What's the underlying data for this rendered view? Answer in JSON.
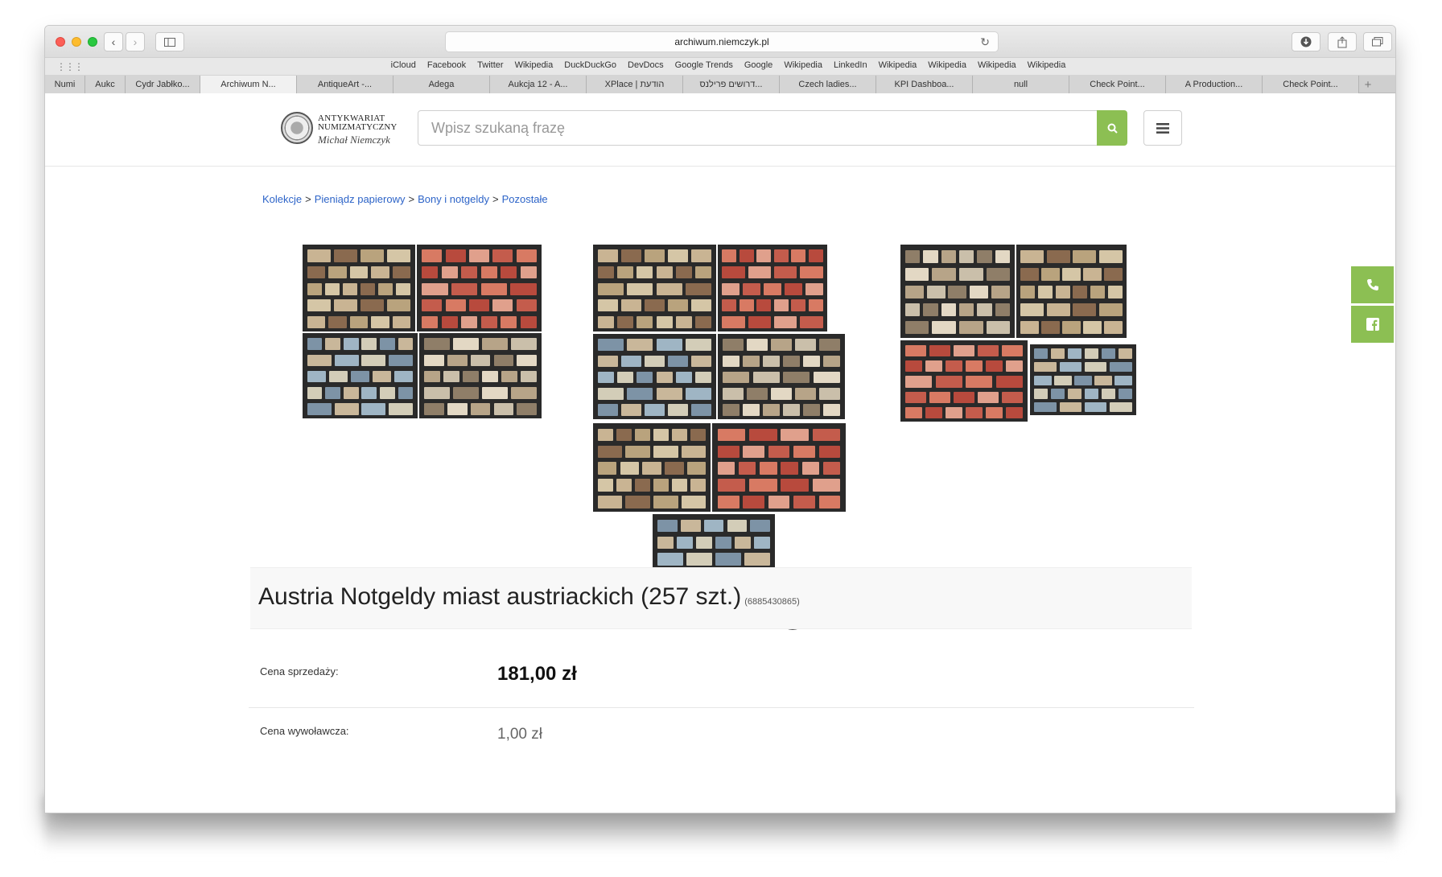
{
  "browser": {
    "url": "archiwum.niemczyk.pl",
    "bookmarks": [
      "iCloud",
      "Facebook",
      "Twitter",
      "Wikipedia",
      "DuckDuckGo",
      "DevDocs",
      "Google Trends",
      "Google",
      "Wikipedia",
      "LinkedIn",
      "Wikipedia",
      "Wikipedia",
      "Wikipedia",
      "Wikipedia"
    ],
    "tabs": [
      "Numi",
      "Aukc",
      "Cydr Jabłko...",
      "Archiwum N...",
      "AntiqueArt -...",
      "Adega",
      "Aukcja 12 - A...",
      "XPlace | הודעת",
      "דרושים פרילנס...",
      "Czech ladies...",
      "KPI Dashboa...",
      "null",
      "Check Point...",
      "A Production...",
      "Check Point..."
    ],
    "active_tab": 3,
    "icons": {
      "back": "chevron-left-icon",
      "forward": "chevron-right-icon",
      "sidebar": "sidebar-icon",
      "reload": "reload-icon",
      "download": "download-icon",
      "share": "share-icon",
      "tabs": "tabs-overview-icon",
      "apps": "apps-grid-icon",
      "new_tab": "plus-icon"
    }
  },
  "site": {
    "logo": {
      "line1": "ANTYKWARIAT",
      "line2": "NUMIZMATYCZNY",
      "line3": "Michał Niemczyk"
    },
    "search_placeholder": "Wpisz szukaną frazę",
    "accent_color": "#8cbf53",
    "link_color": "#2d64c8"
  },
  "breadcrumb": [
    "Kolekcje",
    "Pieniądz papierowy",
    "Bony i notgeldy",
    "Pozostałe"
  ],
  "product": {
    "title": "Austria Notgeldy miast austriackich (257 szt.)",
    "id": "(6885430865)",
    "sale_price_label": "Cena sprzedaży:",
    "sale_price": "181,00 zł",
    "start_price_label": "Cena wywoławcza:",
    "start_price": "1,00 zł"
  }
}
